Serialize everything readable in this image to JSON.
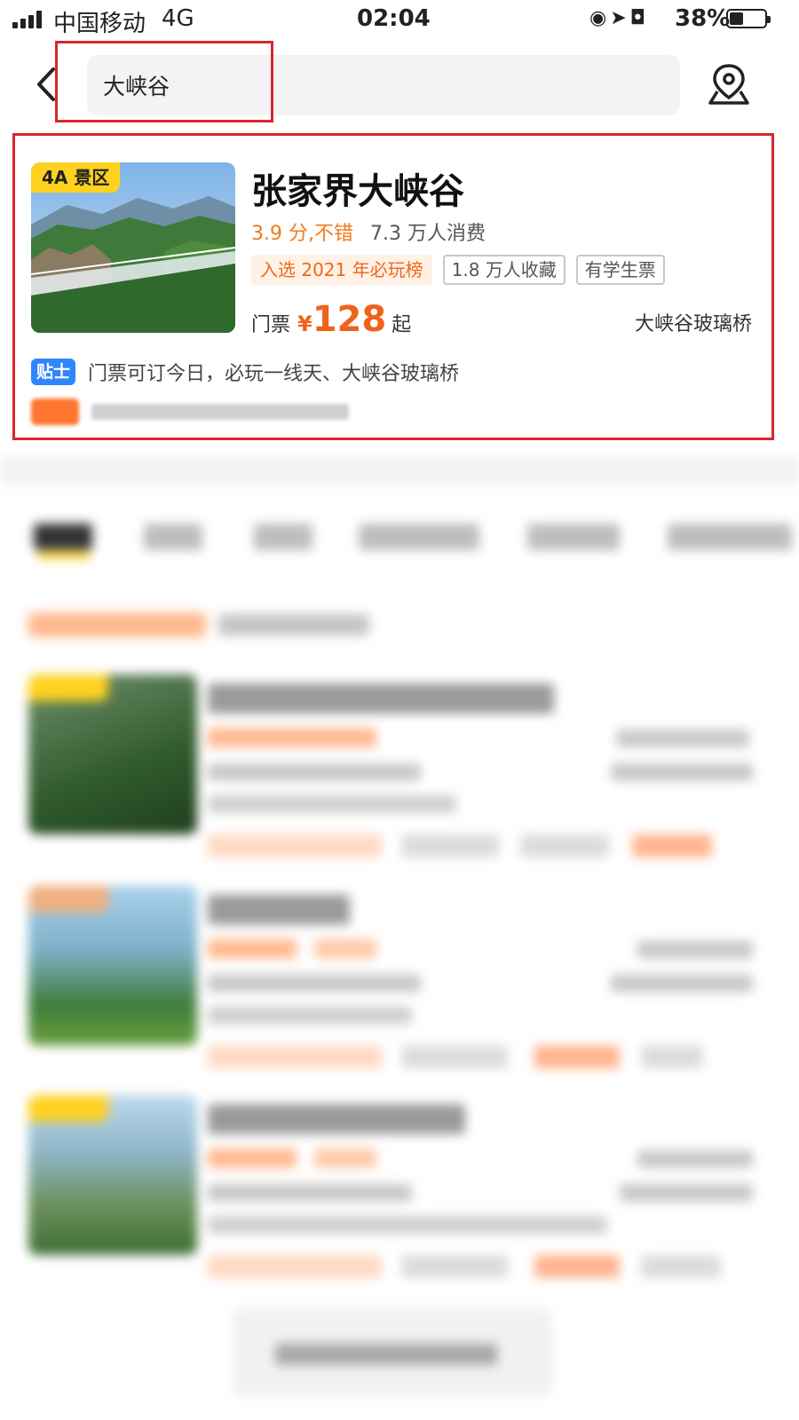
{
  "status_bar": {
    "carrier": "中国移动",
    "network": "4G",
    "time": "02:04",
    "battery": "38%"
  },
  "header": {
    "search_value": "大峡谷",
    "back_icon": "chevron-left-icon",
    "map_icon": "map-pin-icon"
  },
  "result": {
    "badge": "4A 景区",
    "title": "张家界大峡谷",
    "rating": "3.9 分,不错",
    "consumers": "7.3 万人消费",
    "tags": [
      {
        "label": "入选 2021 年必玩榜",
        "style": "hot"
      },
      {
        "label": "1.8 万人收藏",
        "style": "plain"
      },
      {
        "label": "有学生票",
        "style": "plain"
      }
    ],
    "price_label": "门票",
    "price_symbol": "¥",
    "price": "128",
    "price_suffix": "起",
    "location": "大峡谷玻璃桥",
    "tip_badge": "贴士",
    "tip_text": "门票可订今日，必玩一线天、大峡谷玻璃桥"
  },
  "colors": {
    "accent_orange": "#f0621a",
    "highlight_red": "#d7262e",
    "badge_yellow": "#ffd21f",
    "tip_blue": "#2f86ff"
  }
}
